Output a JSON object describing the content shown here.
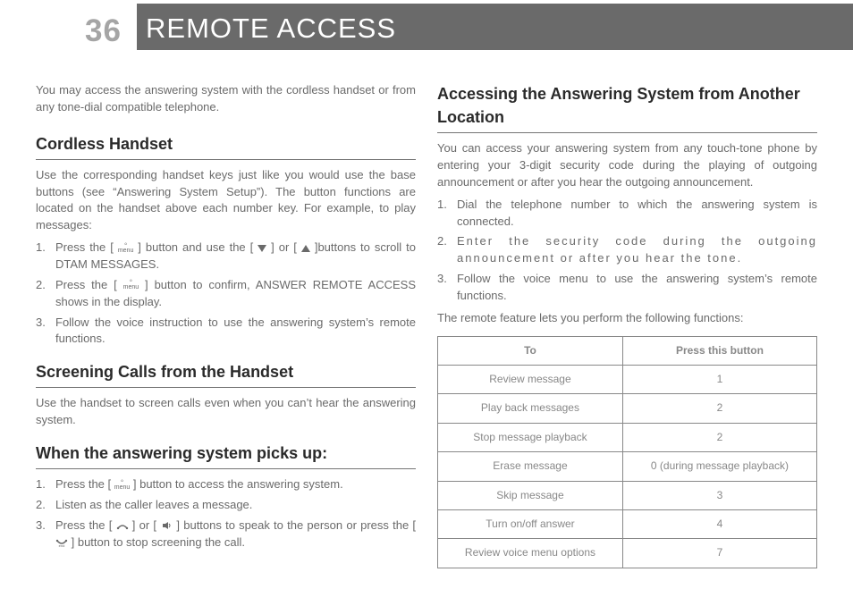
{
  "page_number": "36",
  "header_title": "REMOTE ACCESS",
  "left": {
    "intro": "You may access the answering system with the cordless handset or from any tone-dial compatible telephone.",
    "s1": {
      "heading": "Cordless Handset",
      "p": "Use the corresponding handset keys just like you would use the base buttons (see “Answering System Setup”). The button functions are located on the handset above each number key. For example, to play messages:",
      "items": [
        {
          "pre": "Press the [ ",
          "post": " ] button and use the [ ",
          "post2": " ] or [ ",
          "post3": " ]buttons to scroll to DTAM MESSAGES."
        },
        {
          "pre": "Press the [ ",
          "post": " ] button to confirm, ANSWER REMOTE ACCESS shows in the display."
        },
        {
          "text": "Follow the voice instruction to use the answering system’s remote functions."
        }
      ]
    },
    "s2": {
      "heading": "Screening Calls from the Handset",
      "p": "Use the handset to screen calls even when you can’t hear the answering system."
    },
    "s3": {
      "heading": "When the answering system picks up:",
      "items": [
        {
          "pre": "Press the [ ",
          "post": " ] button to access the answering system."
        },
        {
          "text": "Listen as the caller leaves a message."
        },
        {
          "pre": "Press the [ ",
          "mid1": " ] or [ ",
          "mid2": " ] buttons to speak to the person or press the [ ",
          "post": " ] button to stop screening the call."
        }
      ]
    }
  },
  "right": {
    "s1": {
      "heading": "Accessing the Answering System from Another Location",
      "p": "You can access your answering system from any touch-tone phone by entering your 3-digit security code during the playing of outgoing announcement or after you hear the outgoing announcement.",
      "items": [
        "Dial the telephone number to which the answering system is connected.",
        "Enter the security code during the outgoing announcement or after you hear the tone.",
        "Follow the voice menu to use the answering system’s remote functions."
      ],
      "after": "The remote feature lets you perform the following functions:"
    },
    "table": {
      "headers": [
        "To",
        "Press this button"
      ],
      "rows": [
        [
          "Review message",
          "1"
        ],
        [
          "Play back messages",
          "2"
        ],
        [
          "Stop message playback",
          "2"
        ],
        [
          "Erase message",
          "0 (during message playback)"
        ],
        [
          "Skip message",
          "3"
        ],
        [
          "Turn on/off answer",
          "4"
        ],
        [
          "Review voice menu options",
          "7"
        ]
      ]
    }
  },
  "icons": {
    "menu_label": "menu",
    "end_label": "end"
  }
}
